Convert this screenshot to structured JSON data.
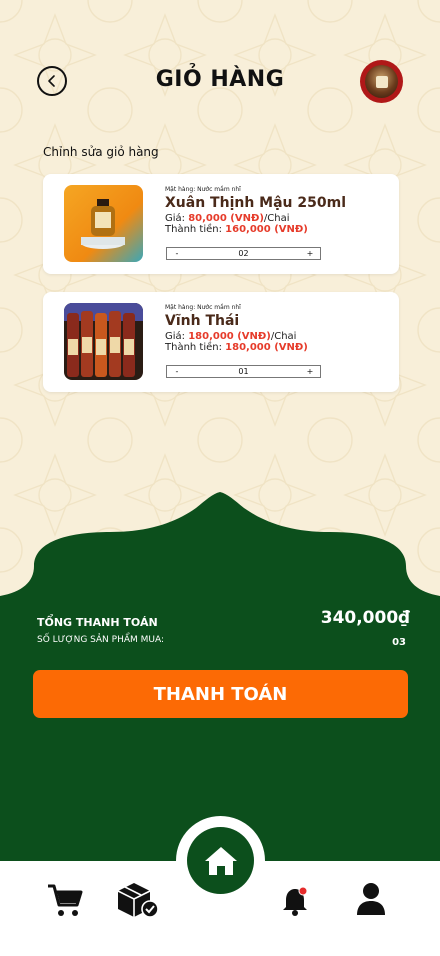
{
  "header": {
    "title": "GIỎ HÀNG",
    "back_icon": "chevron-left-icon",
    "avatar_icon": "product-avatar"
  },
  "cart": {
    "edit_label": "Chỉnh sửa giỏ hàng",
    "items": [
      {
        "category": "Mặt hàng: Nước mắm nhĩ",
        "name": "Xuân Thịnh Mậu 250ml",
        "price_label": "Giá: ",
        "price": "80,000 (VNĐ)",
        "unit": "/Chai",
        "subtotal_label": "Thành tiền: ",
        "subtotal": "160,000 (VNĐ)",
        "qty_minus": "-",
        "quantity": "02",
        "qty_plus": "+"
      },
      {
        "category": "Mặt hàng: Nước mắm nhĩ",
        "name": "Vĩnh Thái",
        "price_label": "Giá: ",
        "price": "180,000 (VNĐ)",
        "unit": "/Chai",
        "subtotal_label": "Thành tiền: ",
        "subtotal": "180,000 (VNĐ)",
        "qty_minus": "-",
        "quantity": "01",
        "qty_plus": "+"
      }
    ]
  },
  "summary": {
    "total_label": "TỔNG THANH TOÁN",
    "total_value": "340,000₫",
    "count_label": "SỐ LƯỢNG SẢN PHẨM MUA:",
    "count_value": "03",
    "pay_button": "THANH TOÁN"
  },
  "nav": {
    "items": [
      "cart-icon",
      "package-check-icon",
      "home-icon",
      "bell-icon",
      "user-icon"
    ]
  },
  "colors": {
    "background": "#f8efd9",
    "green": "#0c4f1c",
    "orange": "#fc6a05",
    "price_red": "#e63b2a",
    "brown": "#4a2a1a"
  }
}
